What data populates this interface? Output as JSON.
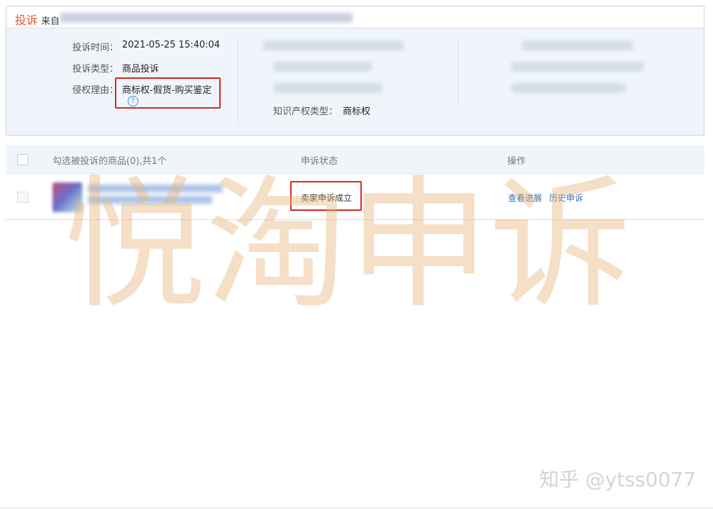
{
  "complaint": {
    "title": "投诉",
    "from_prefix": "来自",
    "fields": {
      "time_label": "投诉时间：",
      "time_value": "2021-05-25 15:40:04",
      "type_label": "投诉类型：",
      "type_value": "商品投诉",
      "reason_label": "侵权理由：",
      "reason_value": "商标权-假货-购买鉴定",
      "help_glyph": "?",
      "ip_type_label": "知识产权类型：",
      "ip_type_value": "商标权"
    }
  },
  "table": {
    "headers": {
      "select_label": "勾选被投诉的商品(0),共1个",
      "status_label": "申诉状态",
      "actions_label": "操作"
    },
    "rows": [
      {
        "status": "卖家申诉成立",
        "actions": [
          "查看进展",
          "历史申诉"
        ]
      }
    ]
  },
  "watermark": {
    "main": "悦淘申诉",
    "credit": "知乎 @ytss0077"
  },
  "icons": {
    "help": "question-circle-icon",
    "checkbox": "checkbox-icon"
  },
  "colors": {
    "title": "#e4572e",
    "panel_bg": "#f0f5fc",
    "highlight_border": "#d9261c",
    "link": "#2f6fb5",
    "watermark": "#e8b278"
  }
}
